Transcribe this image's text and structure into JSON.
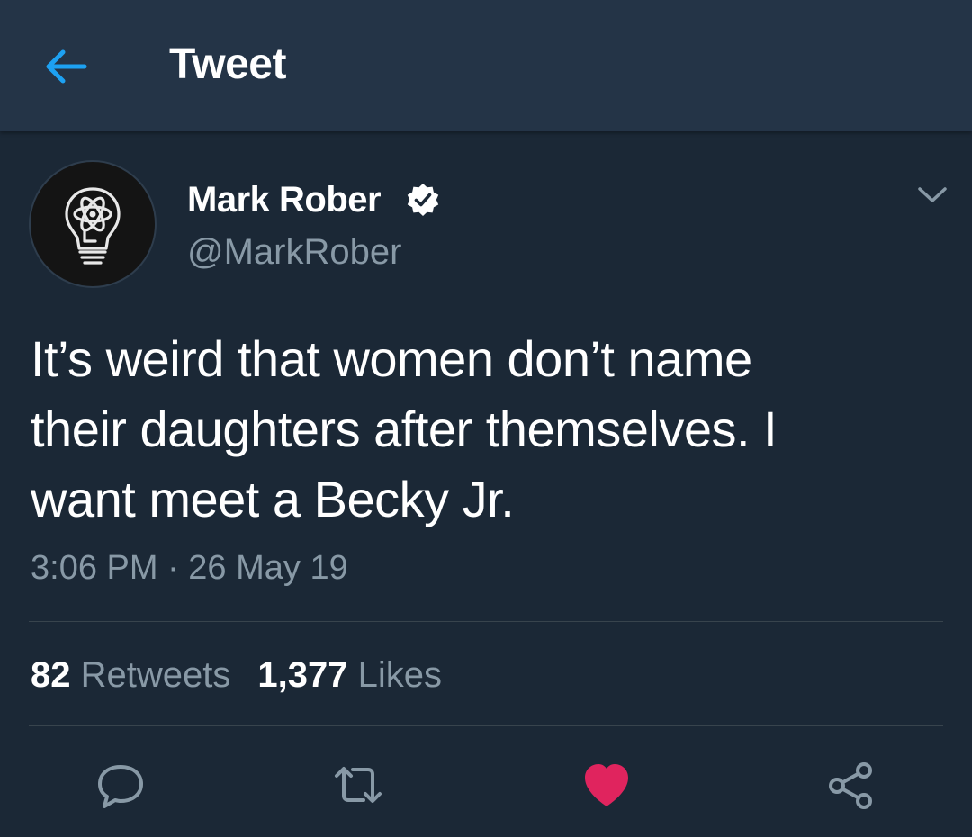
{
  "header": {
    "title": "Tweet",
    "back_icon": "arrow-left-icon"
  },
  "tweet": {
    "author": {
      "display_name": "Mark Rober",
      "handle": "@MarkRober",
      "verified": true,
      "avatar_icon": "atom-lightbulb-logo"
    },
    "text_lines": [
      "It’s weird that women don’t name",
      "their daughters after themselves.  I",
      "want meet a Becky Jr."
    ],
    "timestamp": "3:06 PM · 26 May 19",
    "stats": {
      "retweets_count": "82",
      "retweets_label": "Retweets",
      "likes_count": "1,377",
      "likes_label": "Likes"
    },
    "actions": [
      {
        "name": "reply",
        "icon": "speech-bubble-icon"
      },
      {
        "name": "retweet",
        "icon": "retweet-arrows-icon"
      },
      {
        "name": "like",
        "icon": "heart-icon",
        "active": true
      },
      {
        "name": "share",
        "icon": "share-nodes-icon"
      }
    ]
  },
  "colors": {
    "background": "#1b2836",
    "header_background": "#243447",
    "accent_blue": "#1da1f2",
    "secondary_text": "#8899a6",
    "like_red": "#e0245e",
    "divider": "#38444d"
  }
}
